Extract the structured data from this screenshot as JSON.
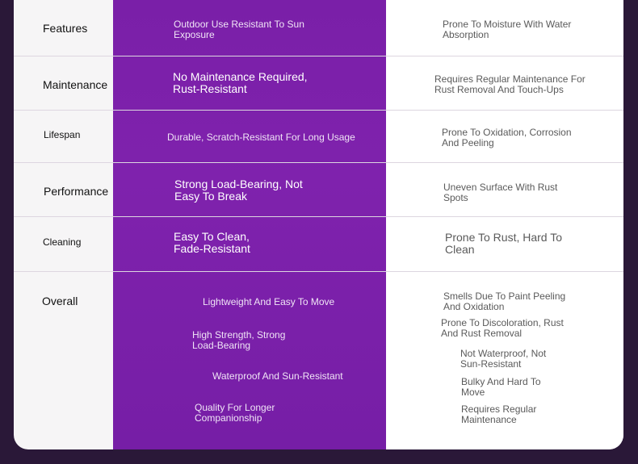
{
  "rows": [
    {
      "label": "Features",
      "mid": [
        "Outdoor Use Resistant To Sun Exposure"
      ],
      "right": [
        "Prone To Moisture With Water Absorption"
      ]
    },
    {
      "label": "Maintenance",
      "mid": [
        "No Maintenance Required, Rust-Resistant"
      ],
      "right": [
        "Requires Regular Maintenance For Rust Removal And Touch-Ups"
      ]
    },
    {
      "label": "Lifespan",
      "mid": [
        "Durable, Scratch-Resistant For Long Usage"
      ],
      "right": [
        "Prone To Oxidation, Corrosion And Peeling"
      ]
    },
    {
      "label": "Performance",
      "mid": [
        "Strong Load-Bearing, Not Easy To Break"
      ],
      "right": [
        "Uneven Surface With Rust Spots"
      ]
    },
    {
      "label": "Cleaning",
      "mid": [
        "Easy To Clean, Fade-Resistant"
      ],
      "right": [
        "Prone To Rust, Hard To Clean"
      ]
    },
    {
      "label": "Overall",
      "mid": [
        "Lightweight And Easy To Move",
        "High Strength, Strong Load-Bearing",
        "Waterproof And Sun-Resistant",
        "Quality For Longer Companionship"
      ],
      "right": [
        "Smells Due To Paint Peeling And Oxidation",
        "Prone To Discoloration, Rust And Rust Removal",
        "Not Waterproof, Not Sun-Resistant",
        "Bulky And Hard To Move",
        "Requires Regular Maintenance"
      ]
    }
  ]
}
